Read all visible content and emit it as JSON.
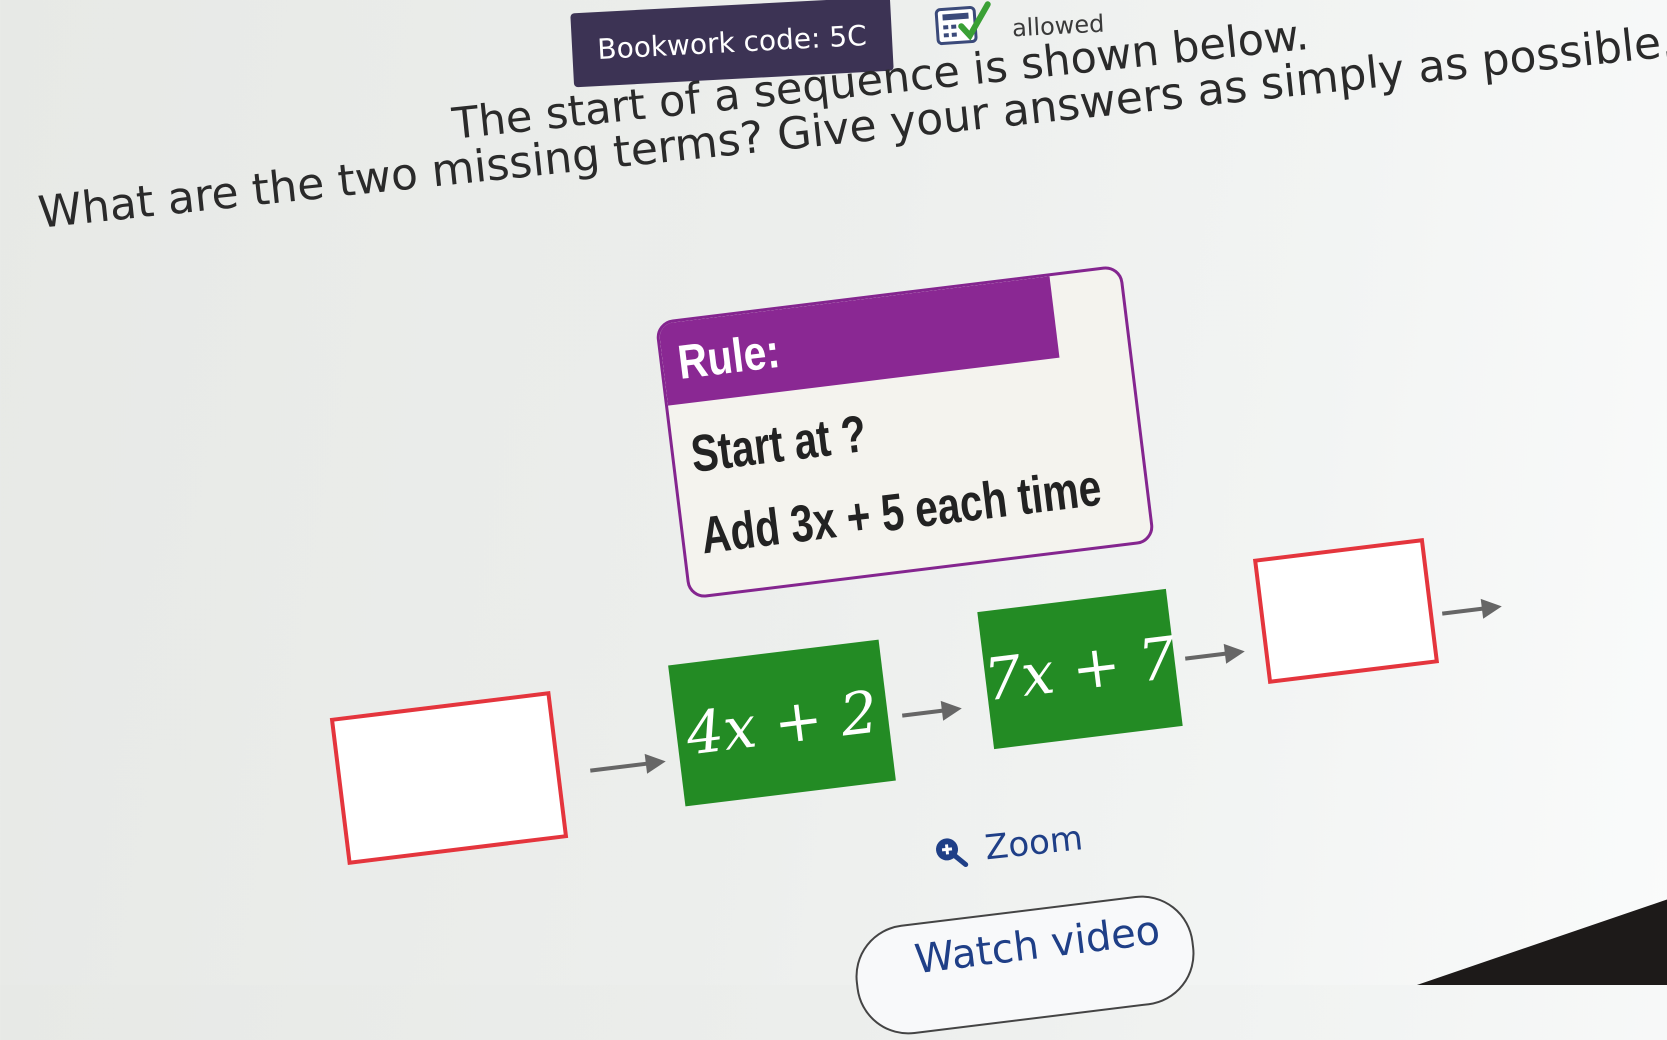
{
  "header": {
    "bookwork_label": "Bookwork code: 5C",
    "calculator_status": "allowed",
    "calculator_icon": "calculator-check-icon"
  },
  "question": {
    "line1": "The start of a sequence is shown below.",
    "line2": "What are the two missing terms? Give your answers as simply as possible."
  },
  "rule": {
    "heading": "Rule:",
    "line1": "Start at ?",
    "line2": "Add 3x + 5 each time"
  },
  "sequence": {
    "terms": [
      "",
      "4x + 2",
      "7x + 7",
      ""
    ]
  },
  "actions": {
    "zoom_label": "Zoom",
    "zoom_icon": "zoom-in-icon",
    "watch_video_label": "Watch video"
  },
  "colors": {
    "bookwork_bg": "#3c3354",
    "rule_purple": "#8a2893",
    "term_green": "#238b24",
    "answer_border_red": "#e4353d",
    "link_blue": "#1f3f87"
  }
}
